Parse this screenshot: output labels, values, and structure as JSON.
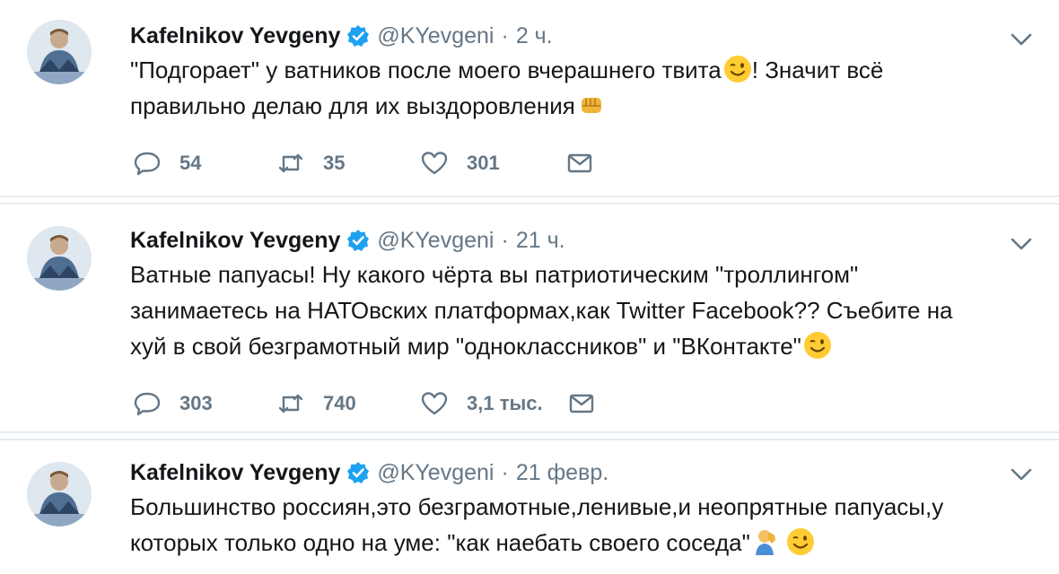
{
  "tweets": [
    {
      "name": "Kafelnikov Yevgeny",
      "handle": "@KYevgeni",
      "separator": "·",
      "time": "2 ч.",
      "lines": [
        "\"Подгорает\" у ватников после моего вчерашнего твита",
        "! Значит всё",
        "правильно делаю для их выздоровления"
      ],
      "replies": "54",
      "retweets": "35",
      "likes": "301"
    },
    {
      "name": "Kafelnikov Yevgeny",
      "handle": "@KYevgeni",
      "separator": "·",
      "time": "21 ч.",
      "lines": [
        "Ватные папуасы! Ну какого чёрта вы патриотическим \"троллингом\"",
        "занимаетесь на НАТОвских платформах,как Twitter Facebook?? Съебите на",
        "хуй в свой безграмотный мир \"одноклассников\" и \"ВКонтакте\""
      ],
      "replies": "303",
      "retweets": "740",
      "likes": "3,1 тыс."
    },
    {
      "name": "Kafelnikov Yevgeny",
      "handle": "@KYevgeni",
      "separator": "·",
      "time": "21 февр.",
      "lines": [
        "Большинство россиян,это безграмотные,ленивые,и неопрятные папуасы,у",
        "которых только одно на уме: \"как наебать своего соседа\""
      ]
    }
  ],
  "icons": {
    "avatar": "profile-photo",
    "verified": "verified-badge-icon",
    "caret": "chevron-down-icon",
    "reply": "reply-bubble-icon",
    "retweet": "retweet-icon",
    "like": "heart-icon",
    "dm": "envelope-icon",
    "emoji_wink": "winking-face-emoji",
    "emoji_fist": "oncoming-fist-emoji",
    "emoji_facepalm": "facepalm-emoji"
  },
  "colors": {
    "text": "#14171a",
    "secondary": "#657786",
    "verified": "#1da1f2",
    "divider": "#e6ecf0"
  }
}
